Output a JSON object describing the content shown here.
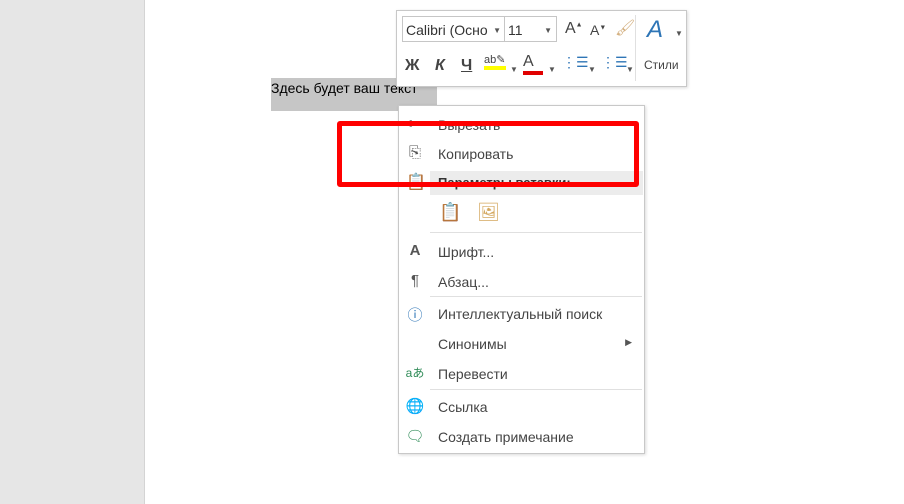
{
  "document": {
    "selected_text": "Здесь будет ваш текст"
  },
  "mini_toolbar": {
    "font_name": "Calibri (Осно",
    "font_size": "11",
    "bold": "Ж",
    "italic": "К",
    "underline": "Ч",
    "styles_label": "Стили",
    "highlight_color": "#ffff00",
    "font_color": "#e00000"
  },
  "context_menu": {
    "items": [
      {
        "label": "Вырезать",
        "icon": "scissors-icon"
      },
      {
        "label": "Копировать",
        "icon": "copy-icon"
      },
      {
        "label": "Параметры вставки:",
        "icon": "paste-icon"
      },
      {
        "label": "Шрифт...",
        "icon": "font-icon"
      },
      {
        "label": "Абзац...",
        "icon": "paragraph-icon"
      },
      {
        "label": "Интеллектуальный поиск",
        "icon": "smart-lookup-icon"
      },
      {
        "label": "Синонимы",
        "icon": ""
      },
      {
        "label": "Перевести",
        "icon": "translate-icon"
      },
      {
        "label": "Ссылка",
        "icon": "link-icon"
      },
      {
        "label": "Создать примечание",
        "icon": "comment-icon"
      }
    ]
  },
  "highlight_color": "#ff0000"
}
